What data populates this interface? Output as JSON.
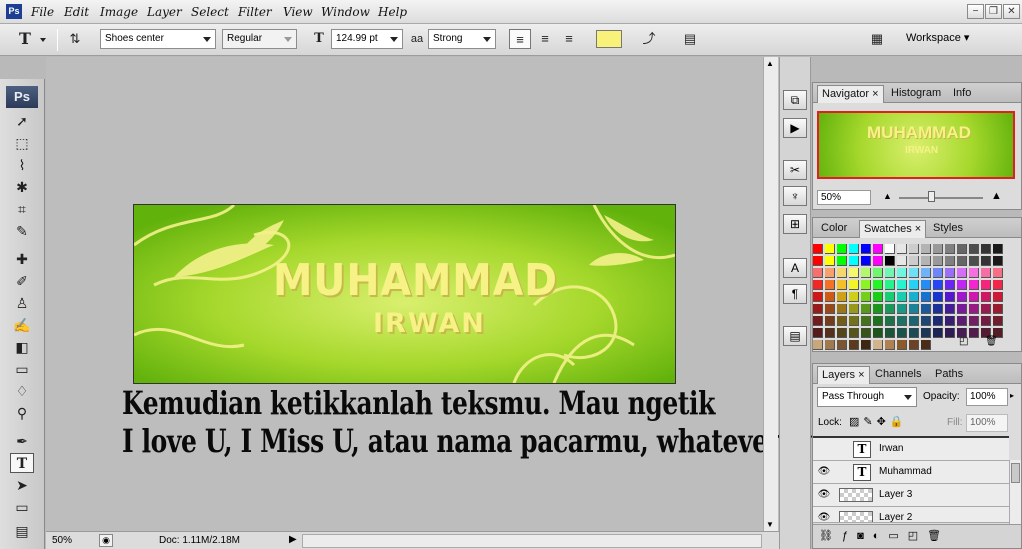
{
  "app": {
    "logo": "Ps"
  },
  "menu": [
    "File",
    "Edit",
    "Image",
    "Layer",
    "Select",
    "Filter",
    "View",
    "Window",
    "Help"
  ],
  "window_controls": {
    "minimize": "−",
    "restore": "❐",
    "close": "✕"
  },
  "options": {
    "tool_glyph": "T",
    "font_family": "Shoes center",
    "font_style": "Regular",
    "font_size": "124.99 pt",
    "aa_label": "aa",
    "antialias": "Strong",
    "text_color": "#f9f27a",
    "workspace": "Workspace"
  },
  "canvas": {
    "banner_line1": "MUHAMMAD",
    "banner_line2": "IRWAN",
    "overlay_line1": "Kemudian ketikkanlah teksmu. Mau ngetik",
    "overlay_line2": "I love U, I Miss U, atau nama pacarmu, whatever :v"
  },
  "status": {
    "zoom": "50%",
    "doc": "Doc: 1.11M/2.18M"
  },
  "navigator": {
    "tabs": [
      "Navigator",
      "Histogram",
      "Info"
    ],
    "zoom": "50%",
    "thumb_line1": "MUHAMMAD",
    "thumb_line2": "IRWAN"
  },
  "swatches_panel": {
    "tabs": [
      "Color",
      "Swatches",
      "Styles"
    ]
  },
  "layers_panel": {
    "tabs": [
      "Layers",
      "Channels",
      "Paths"
    ],
    "blend_mode": "Pass Through",
    "opacity_label": "Opacity:",
    "opacity": "100%",
    "lock_label": "Lock:",
    "fill_label": "Fill:",
    "fill": "100%",
    "layers": [
      {
        "name": "Irwan",
        "kind": "text"
      },
      {
        "name": "Muhammad",
        "kind": "text"
      },
      {
        "name": "Layer 3",
        "kind": "pixel"
      },
      {
        "name": "Layer 2",
        "kind": "pixel"
      }
    ]
  }
}
